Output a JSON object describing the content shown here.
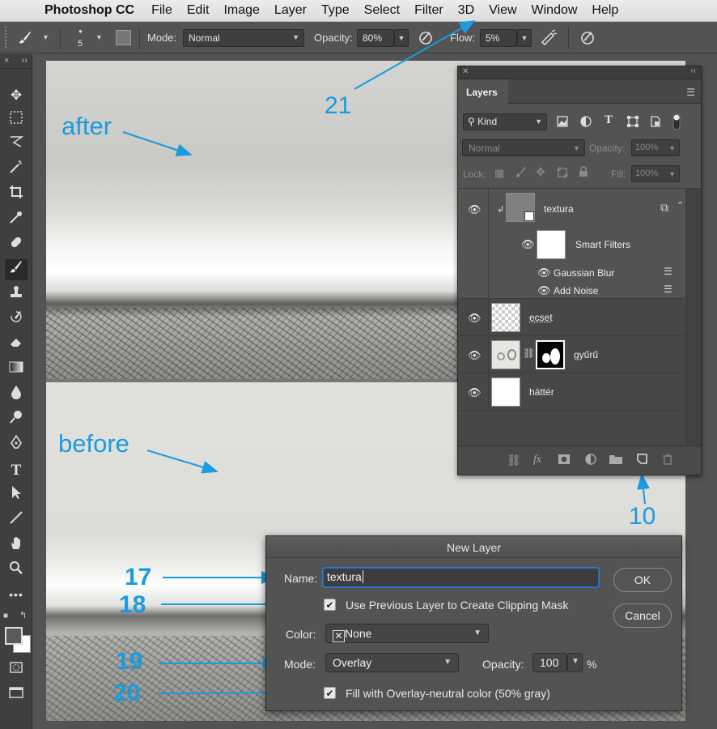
{
  "menubar": {
    "app_name": "Photoshop CC",
    "items": [
      "File",
      "Edit",
      "Image",
      "Layer",
      "Type",
      "Select",
      "Filter",
      "3D",
      "View",
      "Window",
      "Help"
    ]
  },
  "options_bar": {
    "brush_size": "5",
    "mode_label": "Mode:",
    "mode_value": "Normal",
    "opacity_label": "Opacity:",
    "opacity_value": "80%",
    "flow_label": "Flow:",
    "flow_value": "5%"
  },
  "toolbox": {
    "collapse_glyphs": [
      "×",
      "››"
    ]
  },
  "canvas": {
    "after_label": "after",
    "before_label": "before"
  },
  "annotations": {
    "filter_menu": "21",
    "new_layer_button": "10",
    "name_field": "17",
    "clipping_checkbox": "18",
    "mode_select": "19",
    "fill_checkbox": "20"
  },
  "layers_panel": {
    "tab_label": "Layers",
    "filter_label": "Kind",
    "blend_mode": "Normal",
    "opacity_label": "Opacity:",
    "opacity_value": "100%",
    "lock_label": "Lock:",
    "fill_label": "Fill:",
    "fill_value": "100%",
    "layers": [
      {
        "name": "textura"
      },
      {
        "name": "Smart Filters"
      },
      {
        "name": "Gaussian Blur"
      },
      {
        "name": "Add Noise"
      },
      {
        "name": "ecset"
      },
      {
        "name": "gyűrű"
      },
      {
        "name": "háttér"
      }
    ],
    "fx_label": "fx"
  },
  "new_layer_dialog": {
    "title": "New Layer",
    "name_label": "Name:",
    "name_value": "textura",
    "clipping_label": "Use Previous Layer to Create Clipping Mask",
    "clipping_checked": true,
    "color_label": "Color:",
    "color_value": "None",
    "mode_label": "Mode:",
    "mode_value": "Overlay",
    "opacity_label": "Opacity:",
    "opacity_value": "100",
    "opacity_unit": "%",
    "fill_label": "Fill with Overlay-neutral color (50% gray)",
    "fill_checked": true,
    "ok_label": "OK",
    "cancel_label": "Cancel"
  },
  "colors": {
    "annotation": "#1b9be0",
    "panel_bg": "#535353",
    "toolbox_bg": "#3f3f3f"
  }
}
